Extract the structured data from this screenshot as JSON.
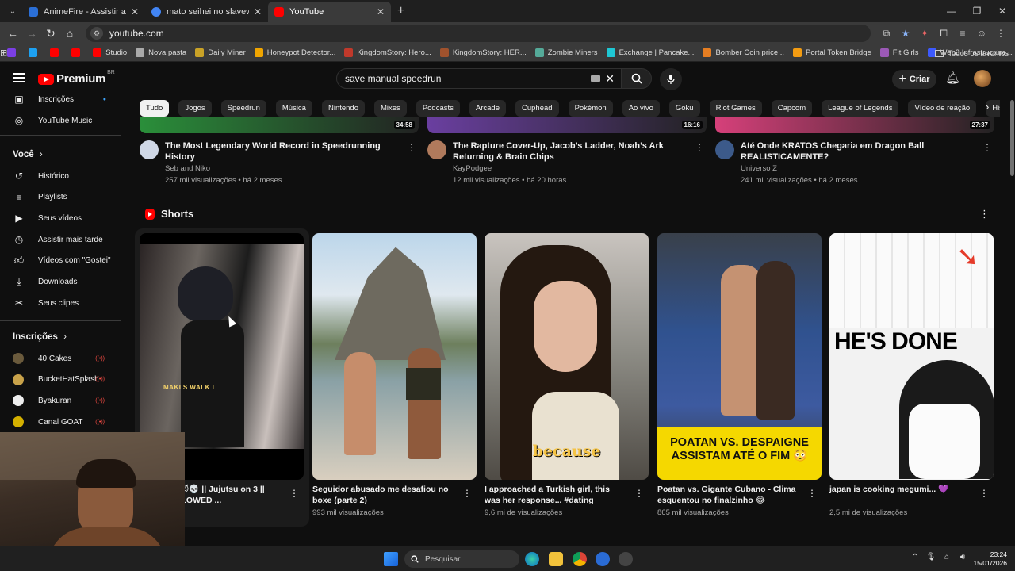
{
  "browser": {
    "tabs": [
      {
        "title": "AnimeFire - Assistir animes onli",
        "color": "#2b6fd6"
      },
      {
        "title": "mato seihei no slavew - Pesquis",
        "color": "#4285f4"
      },
      {
        "title": "YouTube",
        "color": "#ff0000",
        "active": true
      }
    ],
    "new_tab": "+",
    "url": "youtube.com",
    "bookmarks": [
      {
        "label": "",
        "color": "#7b3fe4"
      },
      {
        "label": "",
        "color": "#1da1f2"
      },
      {
        "label": "",
        "color": "#ff0000"
      },
      {
        "label": "",
        "color": "#ff0000"
      },
      {
        "label": "Studio",
        "color": "#ff0000"
      },
      {
        "label": "Nova pasta",
        "color": "#aaa"
      },
      {
        "label": "Daily Miner",
        "color": "#c9a227"
      },
      {
        "label": "Honeypot Detector...",
        "color": "#f0a500"
      },
      {
        "label": "KingdomStory: Hero...",
        "color": "#c0392b"
      },
      {
        "label": "KingdomStory: HER...",
        "color": "#a0522d"
      },
      {
        "label": "Zombie Miners",
        "color": "#5a9"
      },
      {
        "label": "Exchange | Pancake...",
        "color": "#1fc7d4"
      },
      {
        "label": "Bomber Coin price...",
        "color": "#e67e22"
      },
      {
        "label": "Portal Token Bridge",
        "color": "#f39c12"
      },
      {
        "label": "Fit Girls",
        "color": "#9b59b6"
      },
      {
        "label": "Web3 Infrastructure...",
        "color": "#3d5afe"
      }
    ],
    "all_bookmarks": "Todos os favoritos"
  },
  "header": {
    "logo_text": "Premium",
    "region": "BR",
    "search_value": "save manual speedrun",
    "create_label": "Criar"
  },
  "sidebar": {
    "top_item": "Inscrições",
    "music": "YouTube Music",
    "you_heading": "Você",
    "you_items": [
      "Histórico",
      "Playlists",
      "Seus vídeos",
      "Assistir mais tarde",
      "Vídeos com \"Gostei\"",
      "Downloads",
      "Seus clipes"
    ],
    "subs_heading": "Inscrições",
    "subscriptions": [
      {
        "name": "40 Cakes",
        "color": "#6a5a3c"
      },
      {
        "name": "BucketHatSplash",
        "color": "#c8a24a"
      },
      {
        "name": "Byakuran",
        "color": "#eeeeee"
      },
      {
        "name": "Canal GOAT",
        "color": "#d4b000"
      }
    ]
  },
  "chips": [
    "Tudo",
    "Jogos",
    "Speedrun",
    "Música",
    "Nintendo",
    "Mixes",
    "Podcasts",
    "Arcade",
    "Cuphead",
    "Pokémon",
    "Ao vivo",
    "Goku",
    "Riot Games",
    "Capcom",
    "League of Legends",
    "Vídeo de reação",
    "História an"
  ],
  "videos": [
    {
      "duration": "34:58",
      "title": "The Most Legendary World Record in Speedrunning History",
      "channel": "Seb and Niko",
      "stats": "257 mil visualizações • há 2 meses",
      "color": "#2a8f3a"
    },
    {
      "duration": "16:16",
      "title": "The Rapture Cover-Up, Jacob’s Ladder, Noah’s Ark Returning & Brain Chips",
      "channel": "KayPodgee",
      "stats": "12 mil visualizações • há 20 horas",
      "color": "#6a3fa0"
    },
    {
      "duration": "27:37",
      "title": "Até Onde KRATOS Chegaria em Dragon Ball REALISTICAMENTE?",
      "channel": "Universo Z",
      "stats": "241 mil visualizações • há 2 meses",
      "color": "#d6407a"
    }
  ],
  "shorts": {
    "heading": "Shorts",
    "items": [
      {
        "title": "She’s Toji 😈💀 || Jujutsu on 3 || TIKI TIKI SLOWED ...",
        "views": "izações",
        "overlay": "MAKI'S WALK I"
      },
      {
        "title": "Seguidor abusado me desafiou no boxe (parte 2)",
        "views": "993 mil visualizações",
        "overlay": ""
      },
      {
        "title": "I approached a Turkish girl, this was her response... #dating #dateme ...",
        "views": "9,6 mi de visualizações",
        "overlay": "because"
      },
      {
        "title": "Poatan vs. Gigante Cubano - Clima esquentou no finalzinho 😂",
        "views": "865 mil visualizações",
        "overlay": "POATAN VS. DESPAIGNE ASSISTAM ATÉ O FIM 😳"
      },
      {
        "title": "japan is cooking megumi... 💜",
        "views": "2,5 mi de visualizações",
        "overlay": "HE'S DONE"
      }
    ]
  },
  "taskbar": {
    "search_placeholder": "Pesquisar",
    "time": "23:24",
    "date": "15/01/2026"
  }
}
